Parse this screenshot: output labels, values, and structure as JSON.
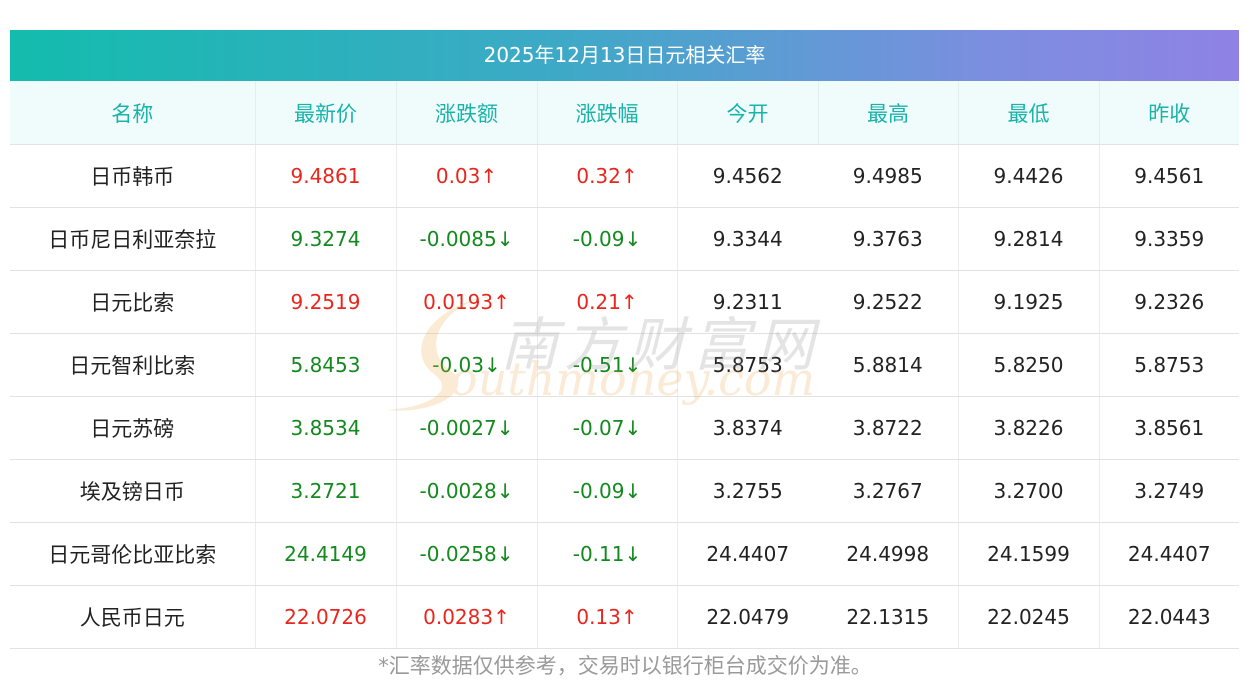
{
  "title": "2025年12月13日日元相关汇率",
  "columns": [
    "名称",
    "最新价",
    "涨跌额",
    "涨跌幅",
    "今开",
    "最高",
    "最低",
    "昨收"
  ],
  "rows": [
    {
      "name": "日币韩币",
      "latest": "9.4861",
      "change": "0.03↑",
      "pct": "0.32↑",
      "open": "9.4562",
      "high": "9.4985",
      "low": "9.4426",
      "prev": "9.4561",
      "trend": "up"
    },
    {
      "name": "日币尼日利亚奈拉",
      "latest": "9.3274",
      "change": "-0.0085↓",
      "pct": "-0.09↓",
      "open": "9.3344",
      "high": "9.3763",
      "low": "9.2814",
      "prev": "9.3359",
      "trend": "down"
    },
    {
      "name": "日元比索",
      "latest": "9.2519",
      "change": "0.0193↑",
      "pct": "0.21↑",
      "open": "9.2311",
      "high": "9.2522",
      "low": "9.1925",
      "prev": "9.2326",
      "trend": "up"
    },
    {
      "name": "日元智利比索",
      "latest": "5.8453",
      "change": "-0.03↓",
      "pct": "-0.51↓",
      "open": "5.8753",
      "high": "5.8814",
      "low": "5.8250",
      "prev": "5.8753",
      "trend": "down"
    },
    {
      "name": "日元苏磅",
      "latest": "3.8534",
      "change": "-0.0027↓",
      "pct": "-0.07↓",
      "open": "3.8374",
      "high": "3.8722",
      "low": "3.8226",
      "prev": "3.8561",
      "trend": "down"
    },
    {
      "name": "埃及镑日币",
      "latest": "3.2721",
      "change": "-0.0028↓",
      "pct": "-0.09↓",
      "open": "3.2755",
      "high": "3.2767",
      "low": "3.2700",
      "prev": "3.2749",
      "trend": "down"
    },
    {
      "name": "日元哥伦比亚比索",
      "latest": "24.4149",
      "change": "-0.0258↓",
      "pct": "-0.11↓",
      "open": "24.4407",
      "high": "24.4998",
      "low": "24.1599",
      "prev": "24.4407",
      "trend": "down"
    },
    {
      "name": "人民币日元",
      "latest": "22.0726",
      "change": "0.0283↑",
      "pct": "0.13↑",
      "open": "22.0479",
      "high": "22.1315",
      "low": "22.0245",
      "prev": "22.0443",
      "trend": "up"
    }
  ],
  "footnote": "*汇率数据仅供参考，交易时以银行柜台成交价为准。",
  "watermark": {
    "cn": "南方财富网",
    "en": "outhmoney.com"
  },
  "colors": {
    "up": "#e8261e",
    "down": "#14891f",
    "header_text": "#1ab3aa",
    "title_grad_start": "#13bcad",
    "title_grad_end": "#8f82e4"
  }
}
